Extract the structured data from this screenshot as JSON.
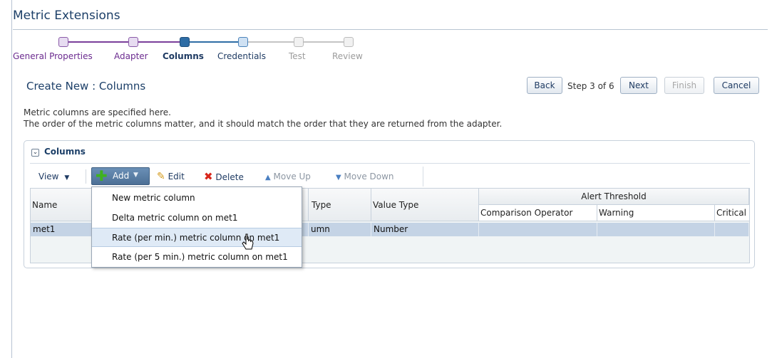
{
  "page": {
    "title": "Metric Extensions"
  },
  "train": {
    "steps": [
      {
        "label": "General Properties",
        "state": "visited"
      },
      {
        "label": "Adapter",
        "state": "visited"
      },
      {
        "label": "Columns",
        "state": "current"
      },
      {
        "label": "Credentials",
        "state": "next"
      },
      {
        "label": "Test",
        "state": "future"
      },
      {
        "label": "Review",
        "state": "future"
      }
    ]
  },
  "header": {
    "subtitle": "Create New : Columns",
    "back_label": "Back",
    "step_text": "Step 3 of 6",
    "next_label": "Next",
    "finish_label": "Finish",
    "cancel_label": "Cancel"
  },
  "description": {
    "line1": "Metric columns are specified here.",
    "line2": "The order of the metric columns matter, and it should match the order that they are returned from the adapter."
  },
  "panel": {
    "title": "Columns",
    "toolbar": {
      "view_label": "View",
      "add_label": "Add",
      "edit_label": "Edit",
      "delete_label": "Delete",
      "move_up_label": "Move Up",
      "move_down_label": "Move Down"
    },
    "table": {
      "headers": {
        "name": "Name",
        "type": "Type",
        "value_type": "Value Type",
        "alert_threshold": "Alert Threshold",
        "comparison_operator": "Comparison Operator",
        "warning": "Warning",
        "critical": "Critical"
      },
      "rows": [
        {
          "name": "met1",
          "type": "umn",
          "value_type": "Number"
        }
      ]
    }
  },
  "add_menu": {
    "items": [
      "New metric column",
      "Delta metric column on met1",
      "Rate (per min.) metric column on met1",
      "Rate (per 5 min.) metric column on met1"
    ]
  },
  "colors": {
    "title": "#1c3f68",
    "visited": "#6b2b8f",
    "selected_row": "#c4d3e5",
    "menu_hover": "#dfeaf6"
  }
}
